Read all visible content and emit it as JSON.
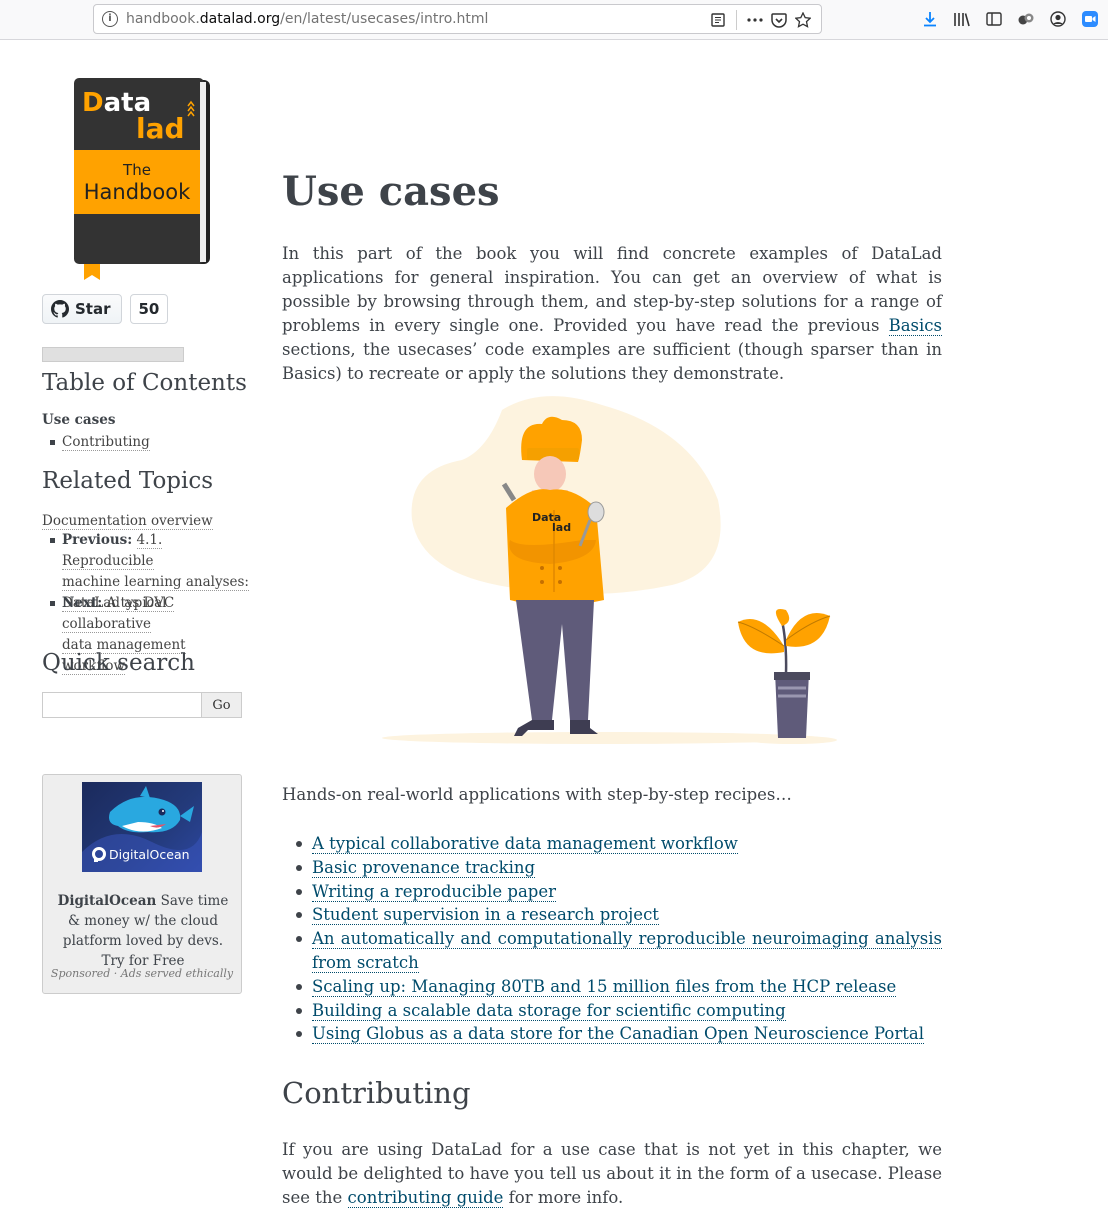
{
  "browser": {
    "url_prefix": "handbook.",
    "url_domain": "datalad.org",
    "url_path": "/en/latest/usecases/intro.html",
    "info_glyph": "i"
  },
  "logo": {
    "line1": "Data",
    "line2": "lad",
    "line3": "The",
    "line4": "Handbook"
  },
  "github": {
    "star_label": "Star",
    "count": "50"
  },
  "sidebar": {
    "toc_heading": "Table of Contents",
    "toc_current": "Use cases",
    "toc_items": [
      "Contributing"
    ],
    "related_heading": "Related Topics",
    "doc_overview": "Documentation overview",
    "prev_label": "Previous:",
    "prev_link_l1": "4.1. Reproducible",
    "prev_link_l2": "machine learning analyses:",
    "prev_link_l3": "DataLad as DVC",
    "next_label": "Next:",
    "next_link_l1": "A typical collaborative",
    "next_link_l2": "data management workflow",
    "search_heading": "Quick search",
    "search_value": "",
    "search_button": "Go"
  },
  "ad": {
    "brand": "DigitalOcean",
    "text": "Save time & money w/ the cloud platform loved by devs. Try for Free",
    "image_brand": "DigitalOcean",
    "footer": "Sponsored · Ads served ethically"
  },
  "main": {
    "title": "Use cases",
    "intro_before": "In this part of the book you will find concrete examples of DataLad applications for general inspiration. You can get an overview of what is possible by browsing through them, and step-by-step solutions for a range of problems in every single one. Provided you have read the previous ",
    "intro_link": "Basics",
    "intro_after": " sections, the usecases’ code examples are sufficient (though sparser than in Basics) to recreate or apply the solutions they demonstrate.",
    "lead": "Hands-on real-world applications with step-by-step recipes…",
    "usecases": [
      "A typical collaborative data management workflow",
      "Basic provenance tracking",
      "Writing a reproducible paper",
      "Student supervision in a research project",
      "An automatically and computationally reproducible neuroimaging analysis from scratch",
      "Scaling up: Managing 80TB and 15 million files from the HCP release",
      "Building a scalable data storage for scientific computing",
      "Using Globus as a data store for the Canadian Open Neuroscience Portal"
    ],
    "contrib_heading": "Contributing",
    "contrib_before": "If you are using DataLad for a use case that is not yet in this chapter, we would be delighted to have you tell us about it in the form of a usecase. Please see the ",
    "contrib_link": "contributing guide",
    "contrib_after": " for more info.",
    "chef_shirt_l1": "Data",
    "chef_shirt_l2": "lad"
  },
  "colors": {
    "accent": "#ffa200",
    "link": "#004b6b",
    "text": "#3e4349"
  }
}
